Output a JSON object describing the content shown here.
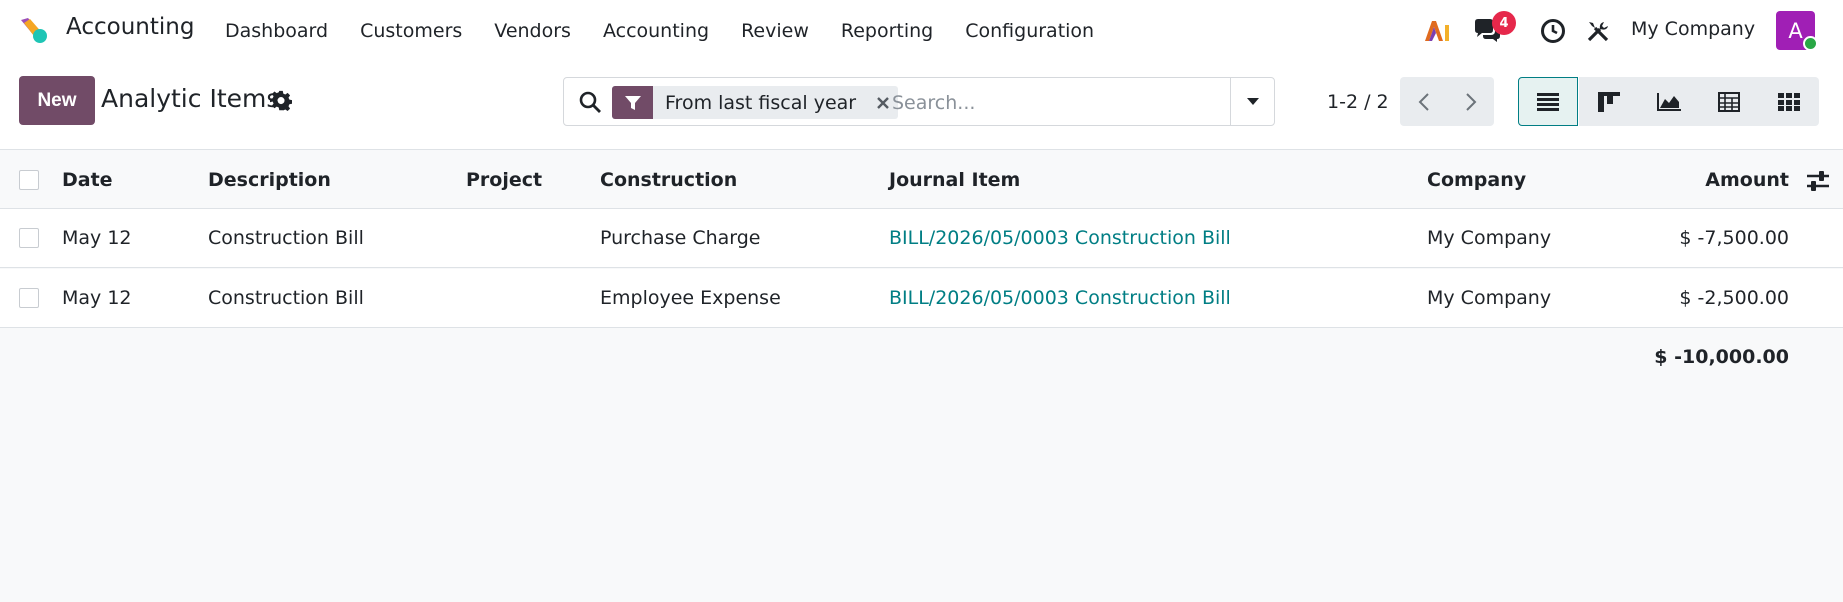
{
  "app": {
    "name": "Accounting"
  },
  "menu": [
    "Dashboard",
    "Customers",
    "Vendors",
    "Accounting",
    "Review",
    "Reporting",
    "Configuration"
  ],
  "systray": {
    "messages_count": "4",
    "company": "My Company",
    "avatar_initial": "A"
  },
  "control": {
    "new_label": "New",
    "title": "Analytic Items",
    "filter_facet": "From last fiscal year",
    "search_placeholder": "Search...",
    "pager": "1-2 / 2"
  },
  "table": {
    "columns": [
      "Date",
      "Description",
      "Project",
      "Construction",
      "Journal Item",
      "Company",
      "Amount"
    ],
    "rows": [
      {
        "date": "May 12",
        "description": "Construction Bill",
        "project": "",
        "construction": "Purchase Charge",
        "journal_item": "BILL/2026/05/0003 Construction Bill",
        "company": "My Company",
        "amount": "$ -7,500.00"
      },
      {
        "date": "May 12",
        "description": "Construction Bill",
        "project": "",
        "construction": "Employee Expense",
        "journal_item": "BILL/2026/05/0003 Construction Bill",
        "company": "My Company",
        "amount": "$ -2,500.00"
      }
    ],
    "total": "$ -10,000.00"
  },
  "colors": {
    "brand": "#714b67",
    "link": "#017e84",
    "badge": "#e6284b",
    "avatar": "#a01fb5"
  },
  "icons": [
    "app-logo-icon",
    "ai-icon",
    "chat-icon",
    "clock-icon",
    "tools-icon",
    "gear-icon",
    "search-icon",
    "filter-icon",
    "close-icon",
    "caret-down-icon",
    "chevron-left-icon",
    "chevron-right-icon",
    "list-view-icon",
    "kanban-view-icon",
    "graph-view-icon",
    "pivot-view-icon",
    "grid-view-icon",
    "column-settings-icon"
  ]
}
